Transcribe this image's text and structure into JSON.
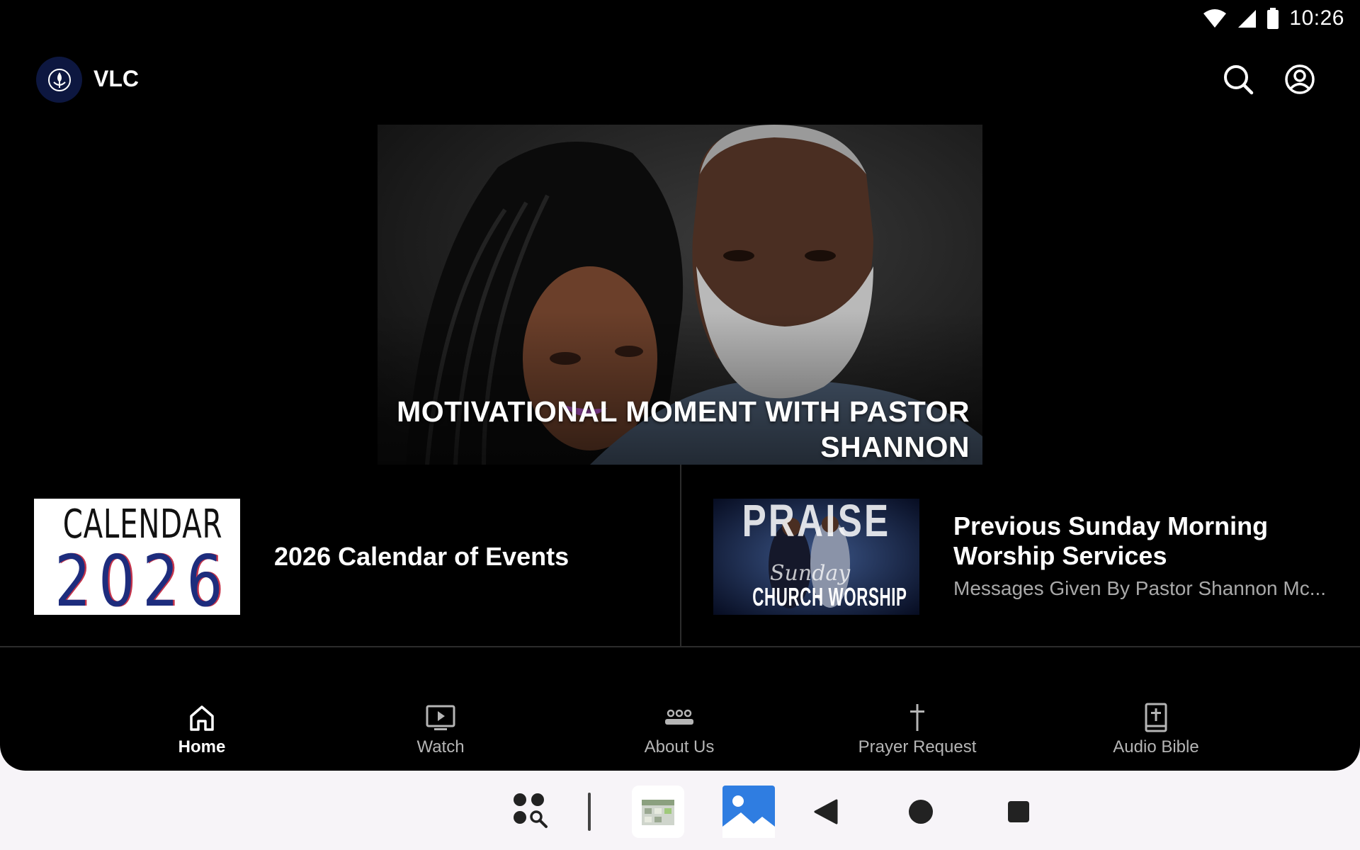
{
  "status_bar": {
    "time": "10:26"
  },
  "app_bar": {
    "title": "VLC"
  },
  "hero": {
    "title": "MOTIVATIONAL MOMENT WITH PASTOR SHANNON"
  },
  "cards": [
    {
      "title": "2026 Calendar of Events",
      "thumbnail_text": {
        "word": "CALENDAR",
        "year": "2026"
      }
    },
    {
      "title": "Previous Sunday Morning Worship Services",
      "subtitle": "Messages Given By Pastor Shannon Mc...",
      "thumbnail_text": {
        "line1": "PRAISE",
        "line2": "Sunday",
        "line3": "CHURCH WORSHIP"
      }
    }
  ],
  "bottom_nav": [
    {
      "label": "Home",
      "icon": "home-icon",
      "active": true
    },
    {
      "label": "Watch",
      "icon": "tv-play-icon",
      "active": false
    },
    {
      "label": "About Us",
      "icon": "group-icon",
      "active": false
    },
    {
      "label": "Prayer Request",
      "icon": "cross-icon",
      "active": false
    },
    {
      "label": "Audio Bible",
      "icon": "bible-icon",
      "active": false
    }
  ],
  "colors": {
    "background": "#000000",
    "logo_bg": "#0d1740",
    "text_secondary": "#a9a9a9",
    "taskbar_bg": "#f7f4f8"
  }
}
